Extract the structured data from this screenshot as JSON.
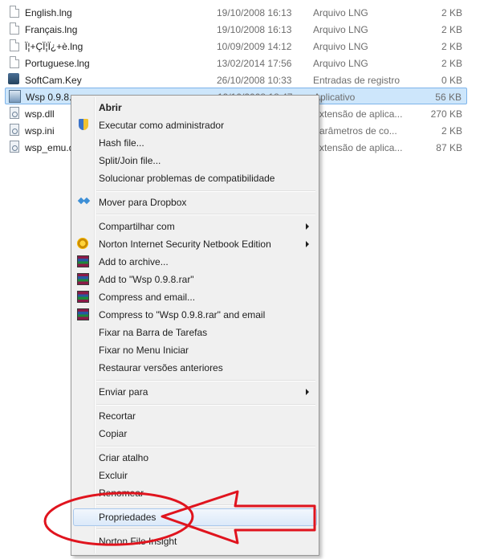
{
  "files": [
    {
      "name": "English.lng",
      "date": "19/10/2008 16:13",
      "type": "Arquivo LNG",
      "size": "2 KB",
      "icon": "document-icon"
    },
    {
      "name": "Français.lng",
      "date": "19/10/2008 16:13",
      "type": "Arquivo LNG",
      "size": "2 KB",
      "icon": "document-icon"
    },
    {
      "name": "Ï¦+ÇÏ¦Ï¿+è.lng",
      "date": "10/09/2009 14:12",
      "type": "Arquivo LNG",
      "size": "2 KB",
      "icon": "document-icon"
    },
    {
      "name": "Portuguese.lng",
      "date": "13/02/2014 17:56",
      "type": "Arquivo LNG",
      "size": "2 KB",
      "icon": "document-icon"
    },
    {
      "name": "SoftCam.Key",
      "date": "26/10/2008 10:33",
      "type": "Entradas de registro",
      "size": "0 KB",
      "icon": "registry-key-icon"
    },
    {
      "name": "Wsp 0.9.8.exe",
      "date": "19/10/2008 18:47",
      "type": "Aplicativo",
      "size": "56 KB",
      "icon": "application-icon"
    },
    {
      "name": "wsp.dll",
      "date": "",
      "type": "Extensão de aplica...",
      "size": "270 KB",
      "icon": "dll-icon"
    },
    {
      "name": "wsp.ini",
      "date": "",
      "type": "Parâmetros de co...",
      "size": "2 KB",
      "icon": "ini-icon"
    },
    {
      "name": "wsp_emu.d",
      "date": "",
      "type": "Extensão de aplica...",
      "size": "87 KB",
      "icon": "dll-icon"
    }
  ],
  "context_menu": {
    "abrir": "Abrir",
    "executar_admin": "Executar como administrador",
    "hash_file": "Hash file...",
    "split_join": "Split/Join file...",
    "solucionar": "Solucionar problemas de compatibilidade",
    "mover_dropbox": "Mover para Dropbox",
    "compartilhar": "Compartilhar com",
    "norton_netbook": "Norton Internet Security Netbook Edition",
    "add_archive": "Add to archive...",
    "add_rar": "Add to \"Wsp 0.9.8.rar\"",
    "compress_email": "Compress and email...",
    "compress_rar_email": "Compress to \"Wsp 0.9.8.rar\" and email",
    "fixar_barra": "Fixar na Barra de Tarefas",
    "fixar_menu": "Fixar no Menu Iniciar",
    "restaurar": "Restaurar versões anteriores",
    "enviar_para": "Enviar para",
    "recortar": "Recortar",
    "copiar": "Copiar",
    "criar_atalho": "Criar atalho",
    "excluir": "Excluir",
    "renomear": "Renomear",
    "propriedades": "Propriedades",
    "norton_insight": "Norton File Insight"
  },
  "colors": {
    "annotation": "#e0141e",
    "selection": "#cde6fb",
    "menu_background": "#f0f0f0"
  }
}
